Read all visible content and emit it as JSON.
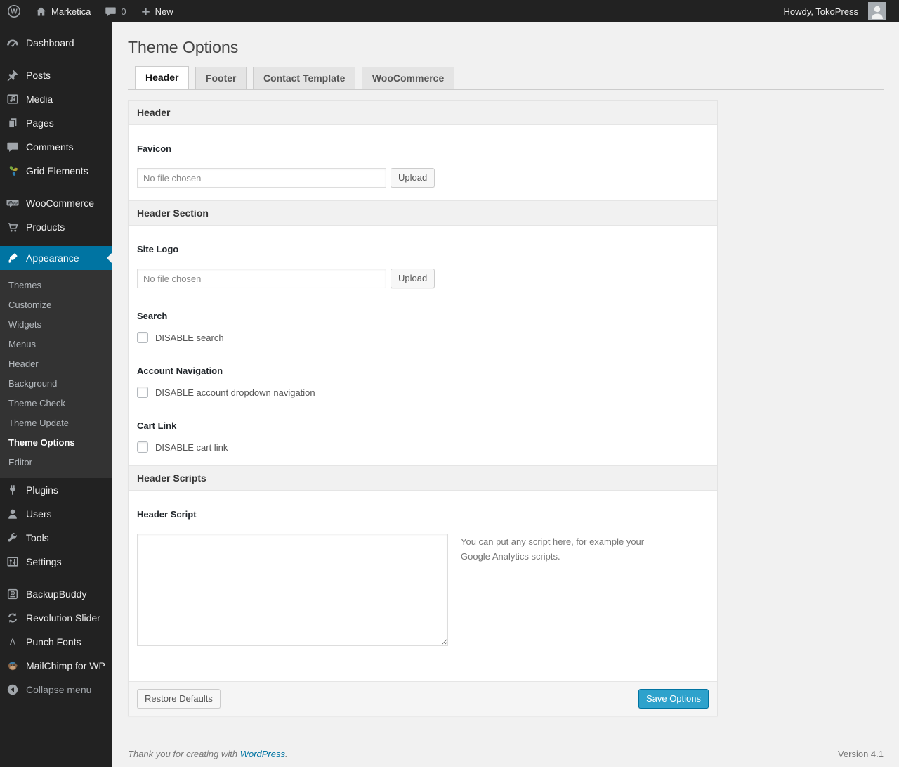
{
  "adminbar": {
    "site_name": "Marketica",
    "comments_count": "0",
    "new_label": "New",
    "howdy": "Howdy, TokoPress"
  },
  "sidebar": {
    "items": [
      {
        "label": "Dashboard"
      },
      {
        "label": "Posts"
      },
      {
        "label": "Media"
      },
      {
        "label": "Pages"
      },
      {
        "label": "Comments"
      },
      {
        "label": "Grid Elements"
      },
      {
        "label": "WooCommerce"
      },
      {
        "label": "Products"
      },
      {
        "label": "Appearance"
      },
      {
        "label": "Plugins"
      },
      {
        "label": "Users"
      },
      {
        "label": "Tools"
      },
      {
        "label": "Settings"
      },
      {
        "label": "BackupBuddy"
      },
      {
        "label": "Revolution Slider"
      },
      {
        "label": "Punch Fonts"
      },
      {
        "label": "MailChimp for WP"
      },
      {
        "label": "Collapse menu"
      }
    ],
    "submenu": {
      "items": [
        "Themes",
        "Customize",
        "Widgets",
        "Menus",
        "Header",
        "Background",
        "Theme Check",
        "Theme Update",
        "Theme Options",
        "Editor"
      ],
      "current": "Theme Options"
    }
  },
  "page": {
    "title": "Theme Options",
    "tabs": [
      {
        "label": "Header",
        "active": true
      },
      {
        "label": "Footer",
        "active": false
      },
      {
        "label": "Contact Template",
        "active": false
      },
      {
        "label": "WooCommerce",
        "active": false
      }
    ]
  },
  "panel": {
    "section_header": "Header",
    "favicon_label": "Favicon",
    "file_placeholder": "No file chosen",
    "upload_label": "Upload",
    "section_header_section": "Header Section",
    "site_logo_label": "Site Logo",
    "search_label": "Search",
    "disable_search_label": "DISABLE search",
    "account_nav_label": "Account Navigation",
    "disable_account_label": "DISABLE account dropdown navigation",
    "cart_link_label": "Cart Link",
    "disable_cart_label": "DISABLE cart link",
    "section_header_scripts": "Header Scripts",
    "header_script_label": "Header Script",
    "script_hint": "You can put any script here, for example your Google Analytics scripts.",
    "restore_label": "Restore Defaults",
    "save_label": "Save Options"
  },
  "footer": {
    "thanks_prefix": "Thank you for creating with ",
    "wordpress_link": "WordPress",
    "period": ".",
    "version": "Version 4.1"
  },
  "colors": {
    "menu_highlight": "#0074a2",
    "primary_button": "#2ea2cc",
    "link": "#0074a2",
    "admin_dark": "#222222",
    "page_background": "#f1f1f1"
  }
}
